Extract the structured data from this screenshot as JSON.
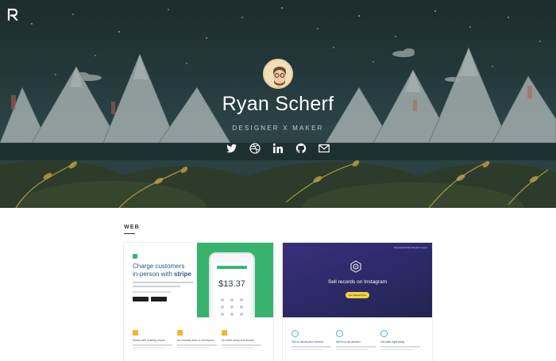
{
  "profile": {
    "name": "Ryan Scherf",
    "role": "DESIGNER X MAKER"
  },
  "social_icons": [
    "twitter-icon",
    "dribbble-icon",
    "linkedin-icon",
    "github-icon",
    "email-icon"
  ],
  "section": {
    "label": "WEB"
  },
  "projects": [
    {
      "headline_part1": "Charge customers",
      "headline_part2": "in-person with",
      "brand": "stripe",
      "amount": "$13.37",
      "features": [
        "Works with existing stores",
        "No monthly fees or minimums",
        "No extra setup and simple"
      ]
    },
    {
      "nav": "Get started   FAQ   Support   Log in",
      "headline": "Sell records on Instagram",
      "cta": "Get Started Now",
      "features": [
        "Tell us about your records",
        "We'll run an auction",
        "Get paid right away"
      ]
    }
  ],
  "colors": {
    "stripe_green": "#38b36e",
    "stripe_text": "#2c5a7d",
    "instagram_purple": "#2f2a6b",
    "accent_yellow": "#f3d23a"
  }
}
